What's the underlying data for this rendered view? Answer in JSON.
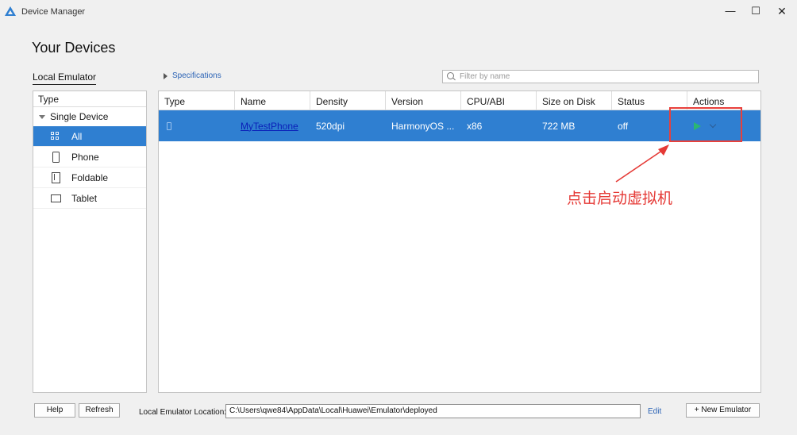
{
  "window": {
    "title": "Device Manager",
    "min": "—",
    "max": "☐",
    "close": "✕"
  },
  "page_title": "Your Devices",
  "tabs": {
    "local": "Local Emulator"
  },
  "specifications": "Specifications",
  "filter": {
    "placeholder": "Filter by name",
    "value": ""
  },
  "type_panel": {
    "header": "Type",
    "group": "Single Device",
    "items": [
      {
        "label": "All",
        "icon": "grid-icon",
        "selected": true
      },
      {
        "label": "Phone",
        "icon": "phone-icon"
      },
      {
        "label": "Foldable",
        "icon": "foldable-icon"
      },
      {
        "label": "Tablet",
        "icon": "tablet-icon"
      }
    ]
  },
  "table": {
    "columns": [
      "Type",
      "Name",
      "Density",
      "Version",
      "CPU/ABI",
      "Size on Disk",
      "Status",
      "Actions"
    ],
    "rows": [
      {
        "name": "MyTestPhone",
        "density": "520dpi",
        "version": "HarmonyOS ...",
        "cpu": "x86",
        "size": "722 MB",
        "status": "off"
      }
    ]
  },
  "annotation": {
    "text": "点击启动虚拟机",
    "color": "#e53935"
  },
  "footer": {
    "help": "Help",
    "refresh": "Refresh",
    "location_label": "Local Emulator Location:",
    "location_value": "C:\\Users\\qwe84\\AppData\\Local\\Huawei\\Emulator\\deployed",
    "edit": "Edit",
    "new_emulator": "+ New Emulator"
  },
  "colors": {
    "accent": "#2f7fd1",
    "play": "#2bb673",
    "link": "#2b63b5"
  }
}
